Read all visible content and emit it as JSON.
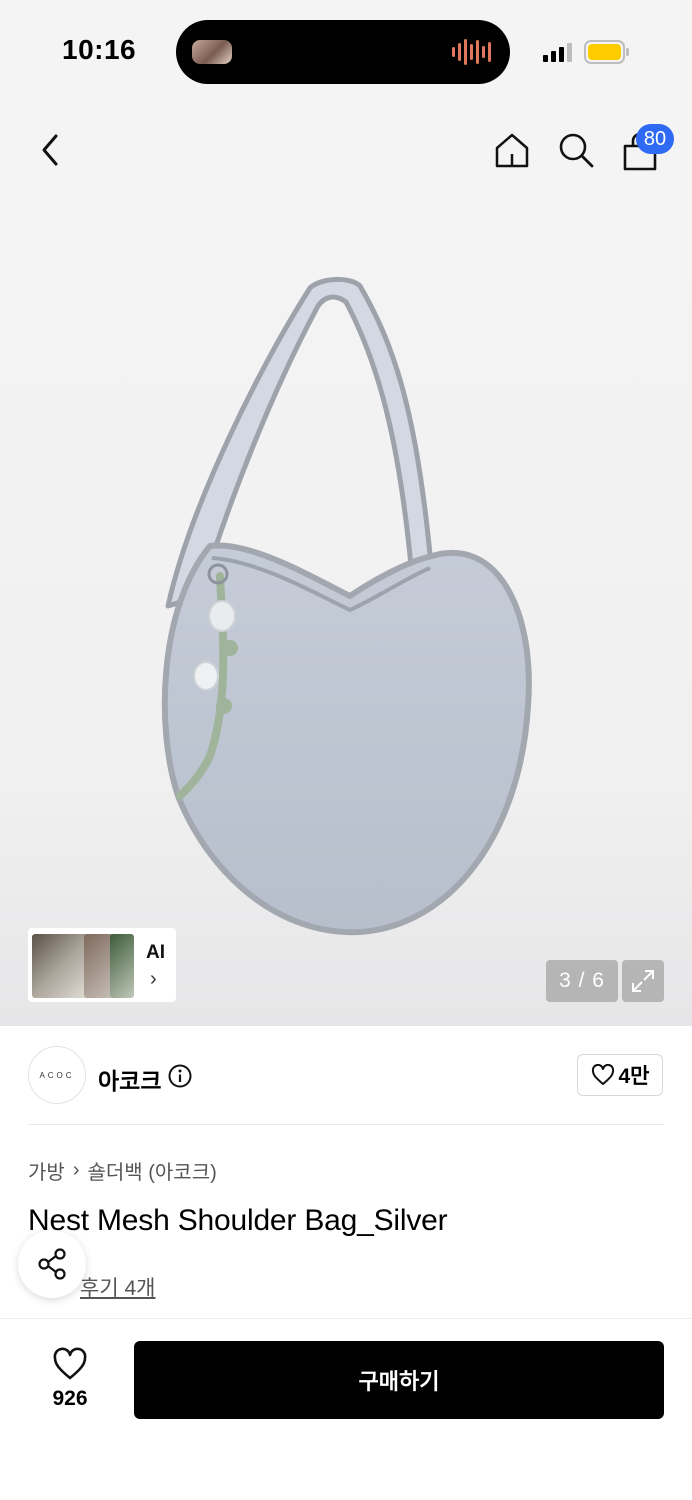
{
  "status_bar": {
    "time": "10:16"
  },
  "nav": {
    "back_icon": "chevron-left-icon",
    "home_icon": "home-icon",
    "search_icon": "search-icon",
    "cart_icon": "shopping-bag-icon",
    "cart_count": "80",
    "badge_color": "#2f6af5"
  },
  "gallery": {
    "ai_label": "AI",
    "counter": "3 / 6",
    "expand_icon": "expand-icon"
  },
  "brand": {
    "logo_text": "ACOC",
    "name": "아코크",
    "info_icon": "info-icon",
    "follower_count": "4만"
  },
  "product": {
    "breadcrumb": [
      "가방",
      "숄더백 (아코크)"
    ],
    "title": "Nest Mesh Shoulder Bag_Silver",
    "review_label": "후기 4개",
    "share_icon": "share-icon"
  },
  "bottom_bar": {
    "like_count": "926",
    "buy_label": "구매하기"
  }
}
